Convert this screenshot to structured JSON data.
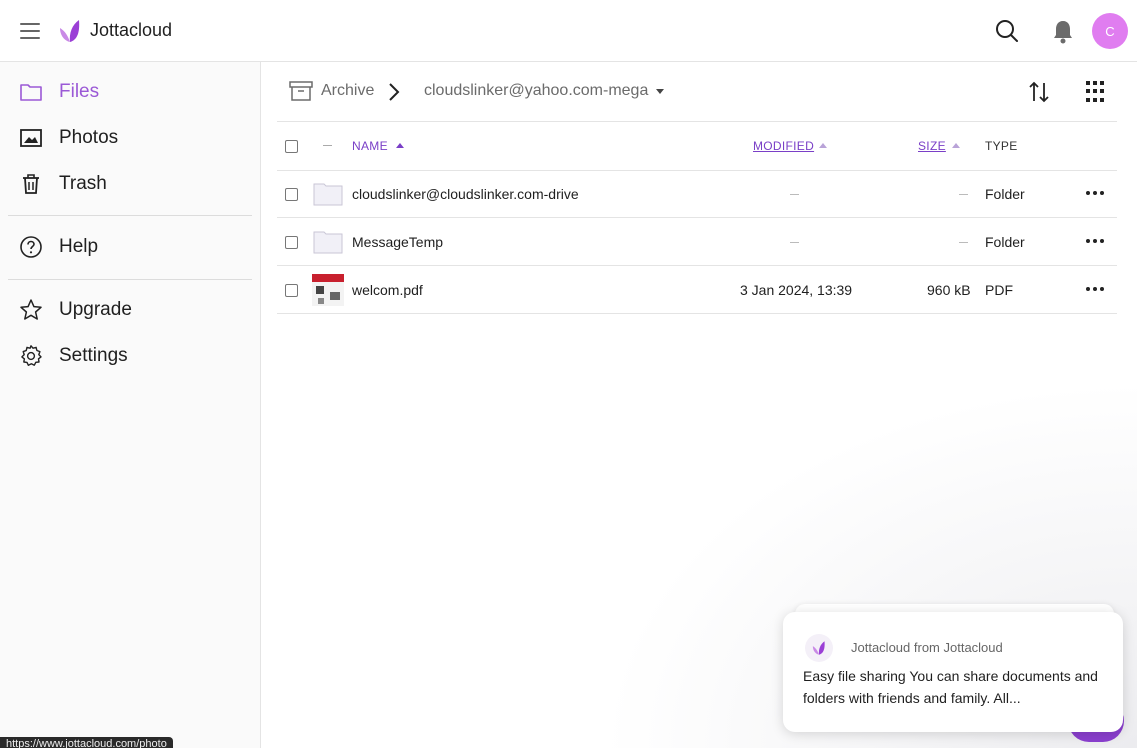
{
  "header": {
    "brand": "Jottacloud",
    "avatar_letter": "C",
    "accent": "#9b59d6",
    "avatar_color": "#e07df0"
  },
  "sidebar": {
    "items": [
      {
        "label": "Files",
        "icon": "folder-icon",
        "active": true
      },
      {
        "label": "Photos",
        "icon": "photo-icon"
      },
      {
        "label": "Trash",
        "icon": "trash-icon"
      },
      {
        "label": "Help",
        "icon": "help-icon"
      },
      {
        "label": "Upgrade",
        "icon": "star-icon"
      },
      {
        "label": "Settings",
        "icon": "gear-icon"
      }
    ]
  },
  "breadcrumb": {
    "root": "Archive",
    "current": "cloudslinker@yahoo.com-mega"
  },
  "table": {
    "headers": {
      "name": "NAME",
      "modified": "MODIFIED",
      "size": "SIZE",
      "type": "TYPE"
    },
    "rows": [
      {
        "name": "cloudslinker@cloudslinker.com-drive",
        "modified": "",
        "size": "",
        "type": "Folder",
        "icon": "folder-icon"
      },
      {
        "name": "MessageTemp",
        "modified": "",
        "size": "",
        "type": "Folder",
        "icon": "folder-icon"
      },
      {
        "name": "welcom.pdf",
        "modified": "3 Jan 2024, 13:39",
        "size": "960 kB",
        "type": "PDF",
        "icon": "pdf-thumbnail"
      }
    ]
  },
  "notification": {
    "from": "Jottacloud from Jottacloud",
    "body": "Easy file sharing You can share documents and folders with friends and family. All..."
  },
  "status_url": "https://www.jottacloud.com/photo"
}
